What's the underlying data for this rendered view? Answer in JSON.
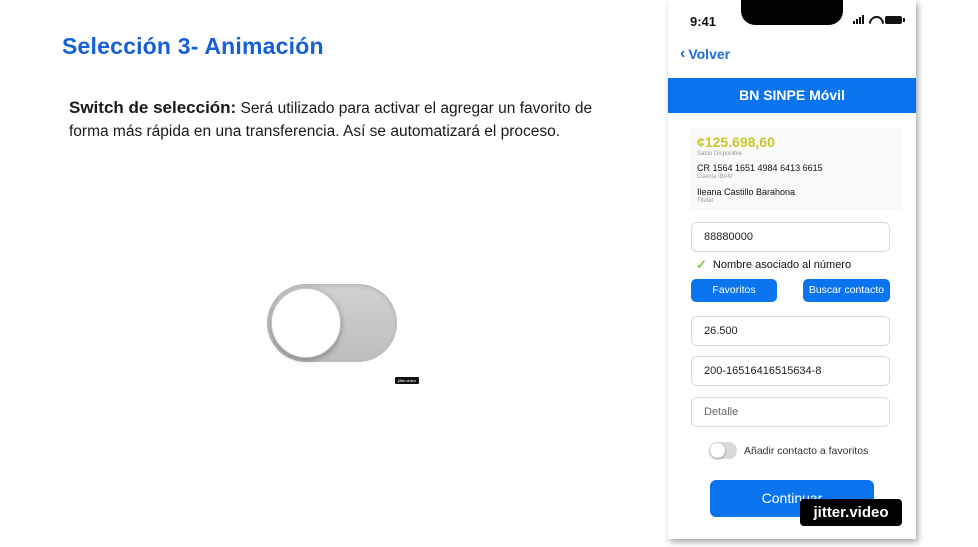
{
  "slide": {
    "title": "Selección 3- Animación",
    "desc_bold": "Switch de selección:",
    "desc_text": " Será utilizado para activar el agregar un favorito de forma más rápida en una transferencia. Así se automatizará el proceso."
  },
  "small_watermark": "jitter.video",
  "phone": {
    "time": "9:41",
    "back_label": "Volver",
    "header_title": "BN SINPE Móvil",
    "balance": "¢125.698,60",
    "balance_label": "Saldo Disponible",
    "account_number": "CR 1564 1651 4984 6413 6615",
    "account_label": "Cuenta IBAN",
    "holder_name": "Ileana Castillo Barahona",
    "holder_label": "Titular",
    "phone_field": "88880000",
    "name_check": "Nombre asociado al número",
    "favorites_button": "Favoritos",
    "search_contact_button": "Buscar contacto",
    "amount_field": "26.500",
    "reference_field": "200-16516416515634-8",
    "detail_placeholder": "Detalle",
    "add_favorite_label": "Añadir contacto a favoritos",
    "add_favorite_on": false,
    "continue_button": "Continuar"
  },
  "watermark": "jitter.video",
  "colors": {
    "title_blue": "#1560d6",
    "primary_blue": "#0a74ef",
    "balance_yellow": "#c9c62a",
    "check_green": "#8bc34a"
  }
}
